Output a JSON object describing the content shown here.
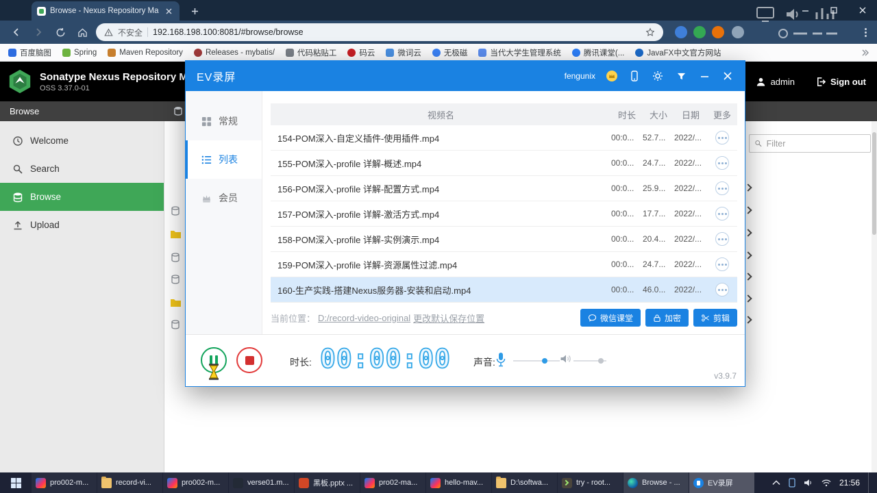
{
  "colors": {
    "ev_accent": "#1a82e2",
    "nexus_green": "#3fa757",
    "record_red": "#d32f2f",
    "pause_green": "#14a45c",
    "timer_blue": "#35a8e8",
    "selected_row": "#d8eafc"
  },
  "browser": {
    "tab_title": "Browse - Nexus Repository Man",
    "address_security": "不安全",
    "address_url": "192.168.198.100:8081/#browse/browse",
    "bookmarks": [
      {
        "label": "百度脑图",
        "color": "#2d6ce0"
      },
      {
        "label": "Spring",
        "color": "#6db33f"
      },
      {
        "label": "Maven Repository",
        "color": "#c77f2e"
      },
      {
        "label": "Releases - mybatis/",
        "color": "#a03a3a"
      },
      {
        "label": "代码粘贴工",
        "color": "#7a7f87"
      },
      {
        "label": "码云",
        "color": "#c71d23"
      },
      {
        "label": "微词云",
        "color": "#4a90e2"
      },
      {
        "label": "无极磁",
        "color": "#3b82f6"
      },
      {
        "label": "当代大学生管理系统",
        "color": "#5b8def"
      },
      {
        "label": "腾讯课堂(...",
        "color": "#2c7ef8"
      },
      {
        "label": "JavaFX中文官方网站",
        "color": "#1b6ac9"
      }
    ]
  },
  "nexus": {
    "brand_title": "Sonatype Nexus Repository Manager",
    "brand_version": "OSS 3.37.0-01",
    "breadcrumb": "Browse",
    "sidebar": [
      {
        "label": "Welcome"
      },
      {
        "label": "Search"
      },
      {
        "label": "Browse"
      },
      {
        "label": "Upload"
      }
    ],
    "user": "admin",
    "signout": "Sign out",
    "filter_placeholder": "Filter"
  },
  "ev": {
    "title": "EV录屏",
    "account": "fengunix",
    "nav": [
      {
        "label": "常规"
      },
      {
        "label": "列表"
      },
      {
        "label": "会员"
      }
    ],
    "table": {
      "headers": [
        "视频名",
        "时长",
        "大小",
        "日期",
        "更多"
      ],
      "rows": [
        {
          "name": "154-POM深入-自定义插件-使用插件.mp4",
          "duration": "00:0...",
          "size": "52.7...",
          "date": "2022/..."
        },
        {
          "name": "155-POM深入-profile 详解-概述.mp4",
          "duration": "00:0...",
          "size": "24.7...",
          "date": "2022/..."
        },
        {
          "name": "156-POM深入-profile 详解-配置方式.mp4",
          "duration": "00:0...",
          "size": "25.9...",
          "date": "2022/..."
        },
        {
          "name": "157-POM深入-profile 详解-激活方式.mp4",
          "duration": "00:0...",
          "size": "17.7...",
          "date": "2022/..."
        },
        {
          "name": "158-POM深入-profile 详解-实例演示.mp4",
          "duration": "00:0...",
          "size": "20.4...",
          "date": "2022/..."
        },
        {
          "name": "159-POM深入-profile 详解-资源属性过滤.mp4",
          "duration": "00:0...",
          "size": "24.7...",
          "date": "2022/..."
        },
        {
          "name": "160-生产实践-搭建Nexus服务器-安装和启动.mp4",
          "duration": "00:0...",
          "size": "46.0...",
          "date": "2022/..."
        }
      ]
    },
    "footer": {
      "location_label": "当前位置：",
      "location_path": "D:/record-video-original",
      "change_link": "更改默认保存位置",
      "btn_wechat": "微信课堂",
      "btn_encrypt": "加密",
      "btn_clip": "剪辑"
    },
    "controls": {
      "duration_label": "时长:",
      "timer": "00:00:00",
      "sound_label": "声音:",
      "version": "v3.9.7"
    }
  },
  "taskbar": {
    "items": [
      {
        "label": "pro002-m..."
      },
      {
        "label": "record-vi..."
      },
      {
        "label": "pro002-m..."
      },
      {
        "label": "verse01.m..."
      },
      {
        "label": "黑板.pptx ..."
      },
      {
        "label": "pro02-ma..."
      },
      {
        "label": "hello-mav..."
      },
      {
        "label": "D:\\softwa..."
      },
      {
        "label": "try - root..."
      },
      {
        "label": "Browse - ..."
      },
      {
        "label": "EV录屏"
      }
    ],
    "tray_time": "21:56"
  }
}
